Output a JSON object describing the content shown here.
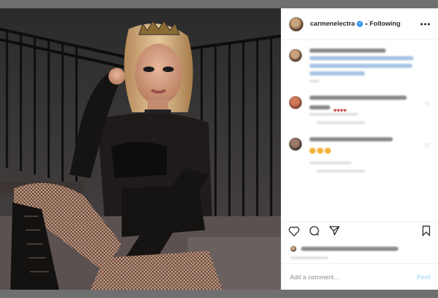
{
  "header": {
    "username": "carmenelectra",
    "verified_glyph": "✓",
    "dot": "•",
    "follow_label": "Following",
    "more_glyph": "•••"
  },
  "comments_glyphs": {
    "hearts": "♥♥♥♥",
    "like": "♡"
  },
  "actions": {
    "like_icon": "heart-icon",
    "comment_icon": "comment-icon",
    "share_icon": "share-icon",
    "save_icon": "bookmark-icon"
  },
  "add_comment": {
    "placeholder": "Add a comment...",
    "post_label": "Post"
  },
  "colors": {
    "verified": "#3897f0",
    "post_disabled": "#b2dffc",
    "window_bg": "#6f6f6f"
  }
}
